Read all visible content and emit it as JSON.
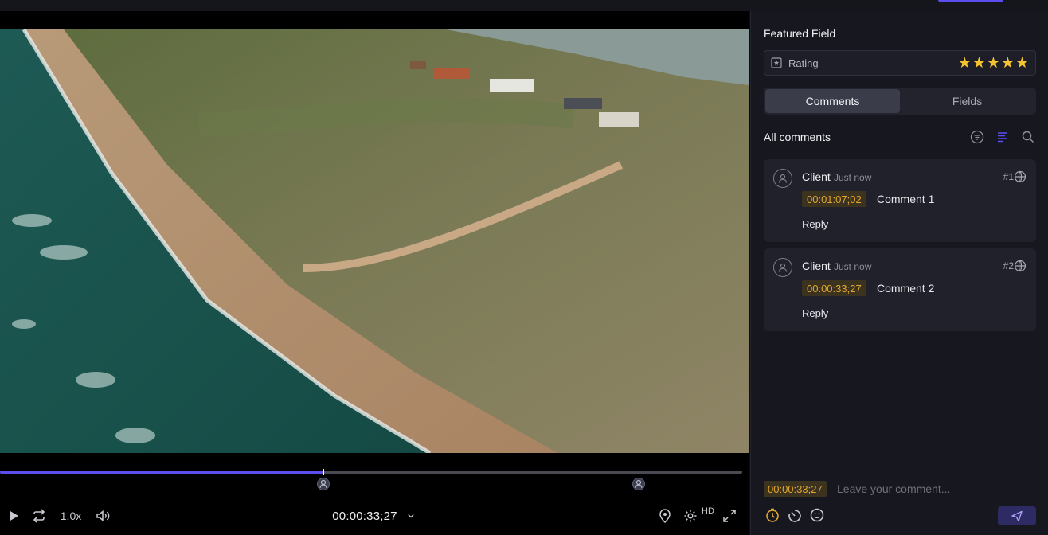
{
  "player": {
    "speed": "1.0x",
    "timecode": "00:00:33;27",
    "quality": "HD",
    "progress_fraction": 0.436,
    "marker_positions_fraction": [
      0.436,
      0.86
    ]
  },
  "panel": {
    "featured_field_title": "Featured Field",
    "rating": {
      "label": "Rating",
      "value": 5,
      "max": 5,
      "star_color": "#f4c430"
    },
    "tabs": [
      {
        "label": "Comments",
        "active": true
      },
      {
        "label": "Fields",
        "active": false
      }
    ],
    "comments_title": "All comments",
    "comments": [
      {
        "author": "Client",
        "time": "Just now",
        "number": "#1",
        "timecode": "00:01:07;02",
        "text": "Comment 1",
        "reply": "Reply"
      },
      {
        "author": "Client",
        "time": "Just now",
        "number": "#2",
        "timecode": "00:00:33;27",
        "text": "Comment 2",
        "reply": "Reply"
      }
    ],
    "composer": {
      "timecode": "00:00:33;27",
      "placeholder": "Leave your comment..."
    }
  },
  "colors": {
    "accent": "#5b4df0",
    "timecode_bg": "#3b3220",
    "timecode_text": "#e3a72f"
  }
}
